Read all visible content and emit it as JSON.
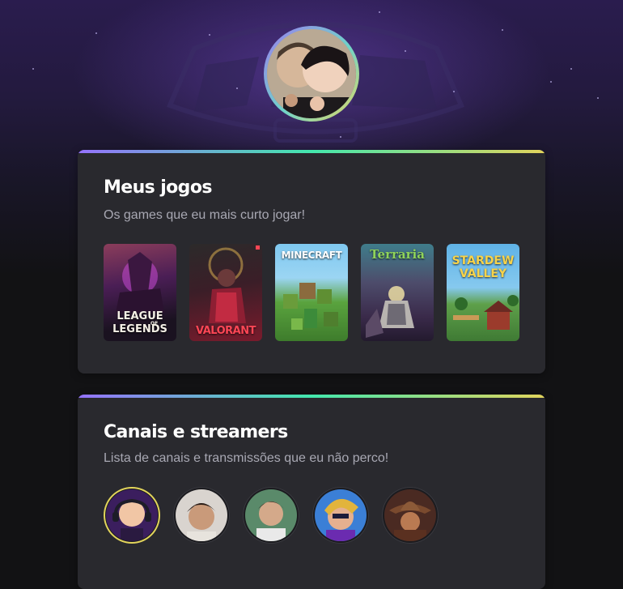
{
  "profile": {
    "avatar_name": "profile-avatar"
  },
  "games_section": {
    "title": "Meus jogos",
    "subtitle": "Os games que eu mais curto jogar!",
    "games": [
      {
        "name": "LEAGUE OF LEGENDS",
        "line1": "LEAGUE",
        "line2": "LEGENDS",
        "small": "OF"
      },
      {
        "name": "VALORANT",
        "label": "VALORANT"
      },
      {
        "name": "MINECRAFT",
        "label": "MINECRAFT"
      },
      {
        "name": "Terraria",
        "label": "Terraria"
      },
      {
        "name": "STARDEW VALLEY",
        "line1": "STARDEW",
        "line2": "VALLEY"
      }
    ]
  },
  "channels_section": {
    "title": "Canais e streamers",
    "subtitle": "Lista de canais e transmissões que eu não perco!"
  },
  "colors": {
    "accent_gradient": [
      "#9572fc",
      "#43e7ad",
      "#e2d45c"
    ],
    "card_bg": "#29292e",
    "page_bg": "#121214"
  }
}
